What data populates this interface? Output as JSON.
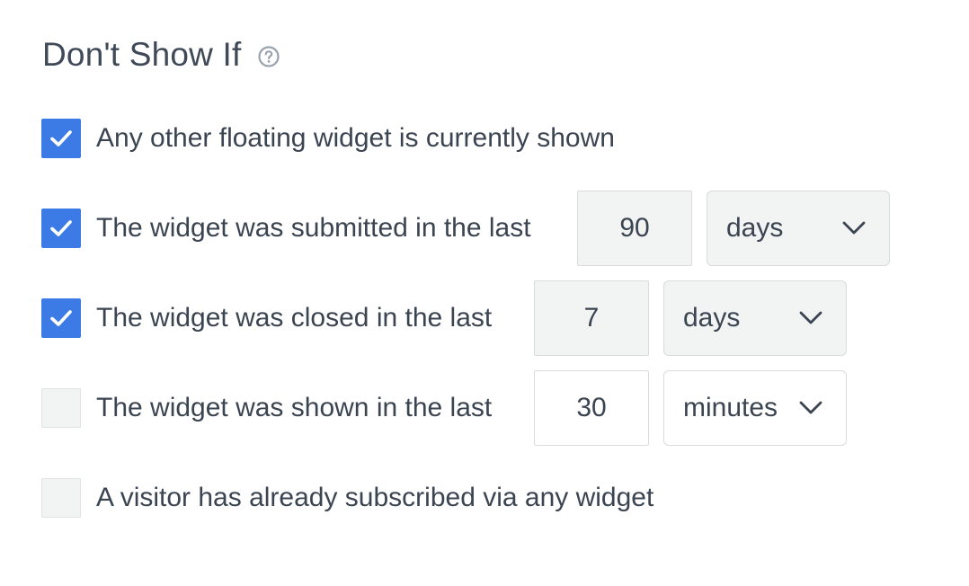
{
  "section": {
    "title": "Don't Show If",
    "help_icon": "question-circle-icon"
  },
  "colors": {
    "checkbox_checked": "#3c7be6",
    "checkbox_unchecked": "#f2f3f3",
    "text": "#3b4451"
  },
  "rows": [
    {
      "label": "Any other floating widget is currently shown",
      "checked": true
    },
    {
      "label": "The widget was submitted in the last",
      "checked": true,
      "value": "90",
      "unit": "days"
    },
    {
      "label": "The widget was closed in the last",
      "checked": true,
      "value": "7",
      "unit": "days"
    },
    {
      "label": "The widget was shown in the last",
      "checked": false,
      "value": "30",
      "unit": "minutes"
    },
    {
      "label": "A visitor has already subscribed via any widget",
      "checked": false
    }
  ]
}
